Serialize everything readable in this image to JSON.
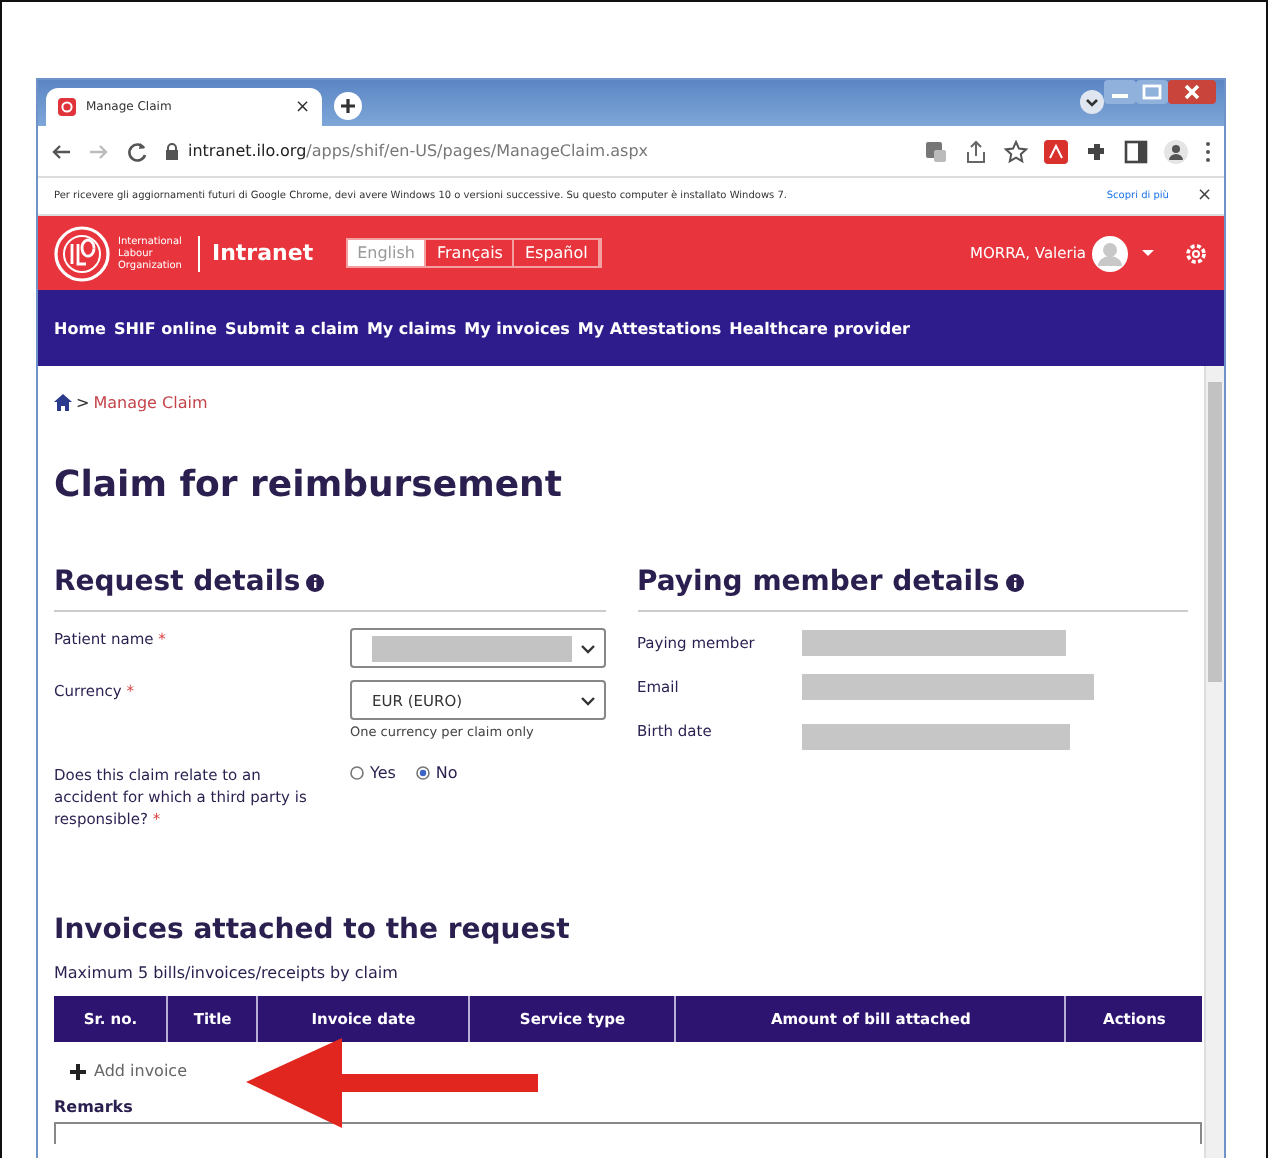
{
  "browser": {
    "tab_title": "Manage Claim",
    "tab_close": "×",
    "url_host": "intranet.ilo.org",
    "url_path": "/apps/shif/en-US/pages/ManageClaim.aspx",
    "infobar": {
      "message": "Per ricevere gli aggiornamenti futuri di Google Chrome, devi avere Windows 10 o versioni successive. Su questo computer è installato Windows 7.",
      "link": "Scopri di più",
      "close": "×"
    }
  },
  "header": {
    "org_name": "International Labour Organization",
    "site_name": "Intranet",
    "languages": [
      {
        "label": "English",
        "selected": true
      },
      {
        "label": "Français",
        "selected": false
      },
      {
        "label": "Español",
        "selected": false
      }
    ],
    "user": "MORRA, Valeria"
  },
  "nav": [
    "Home",
    "SHIF online",
    "Submit a claim",
    "My claims",
    "My invoices",
    "My Attestations",
    "Healthcare provider"
  ],
  "breadcrumb": {
    "separator": ">",
    "current": "Manage Claim"
  },
  "title": "Claim for reimbursement",
  "request_details": {
    "heading": "Request details",
    "fields": [
      {
        "kind": "select",
        "label": "Patient name",
        "required_mark": "*",
        "redacted": true
      },
      {
        "kind": "select",
        "label": "Currency",
        "required_mark": "*",
        "value": "EUR (EURO)",
        "hint": "One currency per claim only"
      },
      {
        "kind": "radio",
        "label": "Does this claim relate to an accident for which a third party is responsible?",
        "required_mark": "*",
        "options": [
          {
            "label": "Yes",
            "selected": false
          },
          {
            "label": "No",
            "selected": true
          }
        ]
      }
    ]
  },
  "paying_member": {
    "heading": "Paying member details",
    "rows": [
      "Paying member",
      "Email",
      "Birth date"
    ]
  },
  "invoices": {
    "heading": "Invoices attached to the request",
    "note": "Maximum 5 bills/invoices/receipts by claim",
    "columns": [
      "Sr. no.",
      "Title",
      "Invoice date",
      "Service type",
      "Amount of bill attached",
      "Actions"
    ],
    "add_link": "Add invoice",
    "remarks_label": "Remarks"
  }
}
